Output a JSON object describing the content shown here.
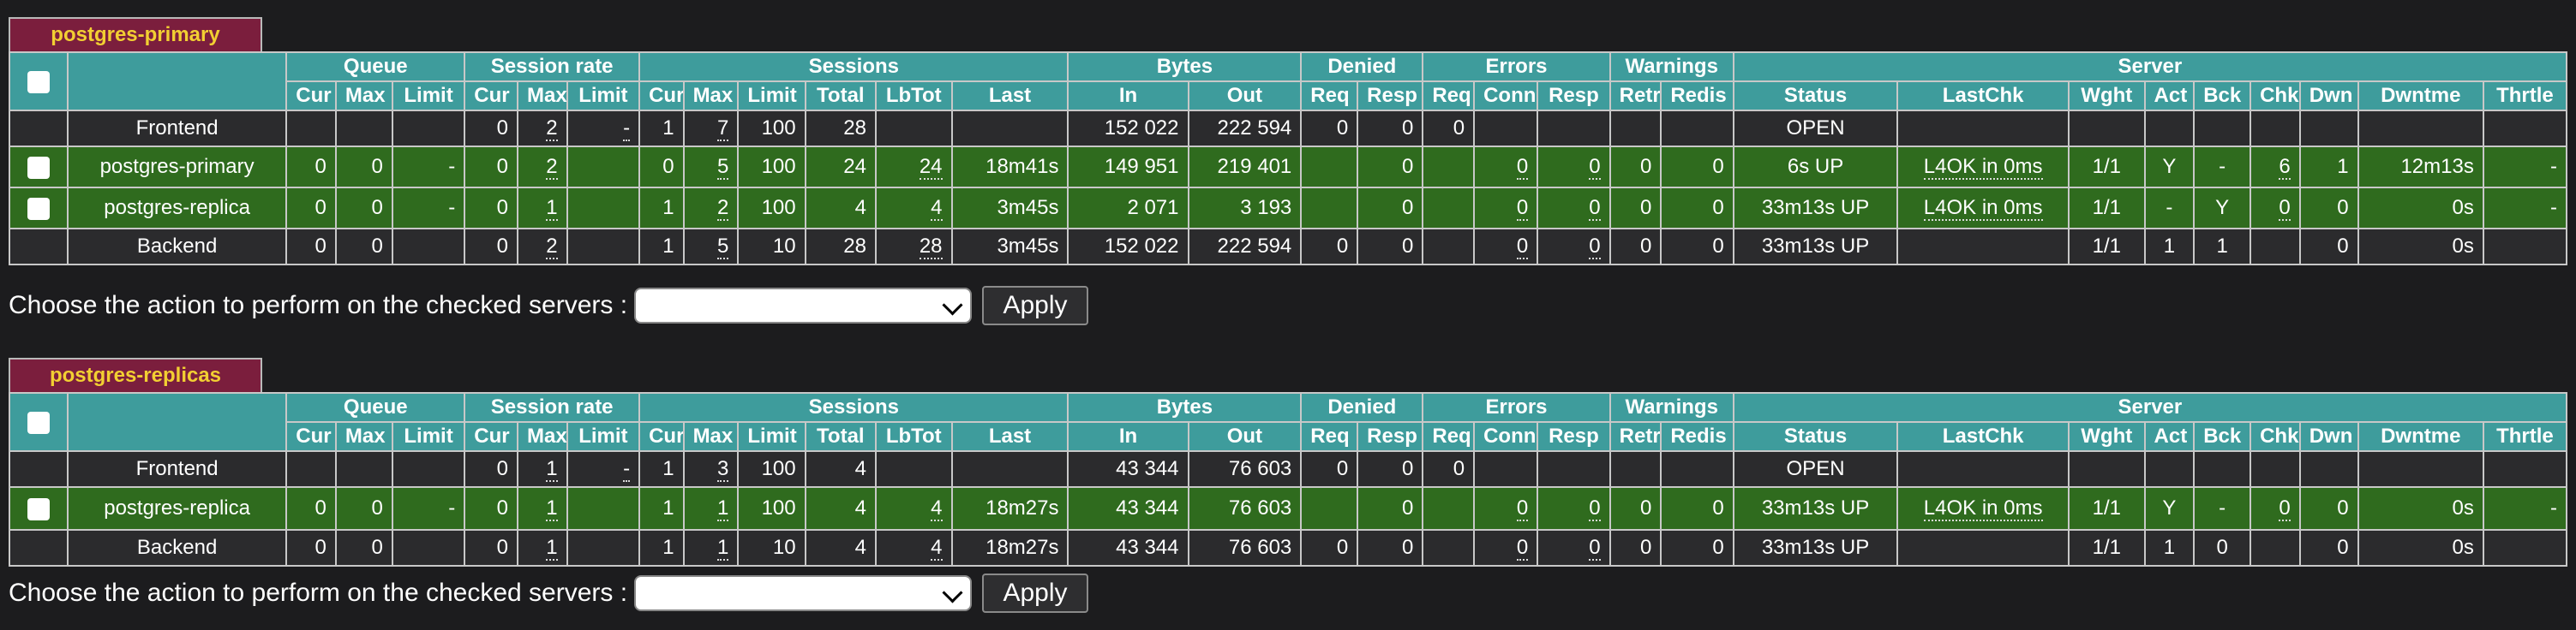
{
  "colors": {
    "header": "#3e9c9c",
    "server_up": "#2f6b1e",
    "row_dark": "#2b2b2d",
    "tab": "#7b1e3d",
    "tab_text": "#f2cf32"
  },
  "headers": {
    "groups": [
      "Queue",
      "Session rate",
      "Sessions",
      "Bytes",
      "Denied",
      "Errors",
      "Warnings",
      "Server"
    ],
    "sub": [
      "Cur",
      "Max",
      "Limit",
      "Cur",
      "Max",
      "Limit",
      "Cur",
      "Max",
      "Limit",
      "Total",
      "LbTot",
      "Last",
      "In",
      "Out",
      "Req",
      "Resp",
      "Req",
      "Conn",
      "Resp",
      "Retr",
      "Redis",
      "Status",
      "LastChk",
      "Wght",
      "Act",
      "Bck",
      "Chk",
      "Dwn",
      "Dwntme",
      "Thrtle"
    ]
  },
  "action": {
    "label": "Choose the action to perform on the checked servers :",
    "apply": "Apply",
    "selected": ""
  },
  "proxies": [
    {
      "name": "postgres-primary",
      "frontend": [
        "Frontend",
        "",
        "",
        "",
        "0",
        "2",
        "-",
        "1",
        "7",
        "100",
        "28",
        "",
        "",
        "152 022",
        "222 594",
        "0",
        "0",
        "0",
        "",
        "",
        "",
        "",
        "OPEN",
        "",
        "",
        "",
        "",
        "",
        "",
        "",
        ""
      ],
      "servers": [
        [
          "postgres-primary",
          "0",
          "0",
          "-",
          "0",
          "2",
          "",
          "0",
          "5",
          "100",
          "24",
          "24",
          "18m41s",
          "149 951",
          "219 401",
          "",
          "0",
          "",
          "0",
          "0",
          "0",
          "0",
          "6s UP",
          "L4OK in 0ms",
          "1/1",
          "Y",
          "-",
          "6",
          "1",
          "12m13s",
          "-"
        ],
        [
          "postgres-replica",
          "0",
          "0",
          "-",
          "0",
          "1",
          "",
          "1",
          "2",
          "100",
          "4",
          "4",
          "3m45s",
          "2 071",
          "3 193",
          "",
          "0",
          "",
          "0",
          "0",
          "0",
          "0",
          "33m13s UP",
          "L4OK in 0ms",
          "1/1",
          "-",
          "Y",
          "0",
          "0",
          "0s",
          "-"
        ]
      ],
      "backend": [
        "Backend",
        "0",
        "0",
        "",
        "0",
        "2",
        "",
        "1",
        "5",
        "10",
        "28",
        "28",
        "3m45s",
        "152 022",
        "222 594",
        "0",
        "0",
        "",
        "0",
        "0",
        "0",
        "0",
        "33m13s UP",
        "",
        "1/1",
        "1",
        "1",
        "",
        "0",
        "0s",
        ""
      ]
    },
    {
      "name": "postgres-replicas",
      "frontend": [
        "Frontend",
        "",
        "",
        "",
        "0",
        "1",
        "-",
        "1",
        "3",
        "100",
        "4",
        "",
        "",
        "43 344",
        "76 603",
        "0",
        "0",
        "0",
        "",
        "",
        "",
        "",
        "OPEN",
        "",
        "",
        "",
        "",
        "",
        "",
        "",
        ""
      ],
      "servers": [
        [
          "postgres-replica",
          "0",
          "0",
          "-",
          "0",
          "1",
          "",
          "1",
          "1",
          "100",
          "4",
          "4",
          "18m27s",
          "43 344",
          "76 603",
          "",
          "0",
          "",
          "0",
          "0",
          "0",
          "0",
          "33m13s UP",
          "L4OK in 0ms",
          "1/1",
          "Y",
          "-",
          "0",
          "0",
          "0s",
          "-"
        ]
      ],
      "backend": [
        "Backend",
        "0",
        "0",
        "",
        "0",
        "1",
        "",
        "1",
        "1",
        "10",
        "4",
        "4",
        "18m27s",
        "43 344",
        "76 603",
        "0",
        "0",
        "",
        "0",
        "0",
        "0",
        "0",
        "33m13s UP",
        "",
        "1/1",
        "1",
        "0",
        "",
        "0",
        "0s",
        ""
      ]
    }
  ]
}
